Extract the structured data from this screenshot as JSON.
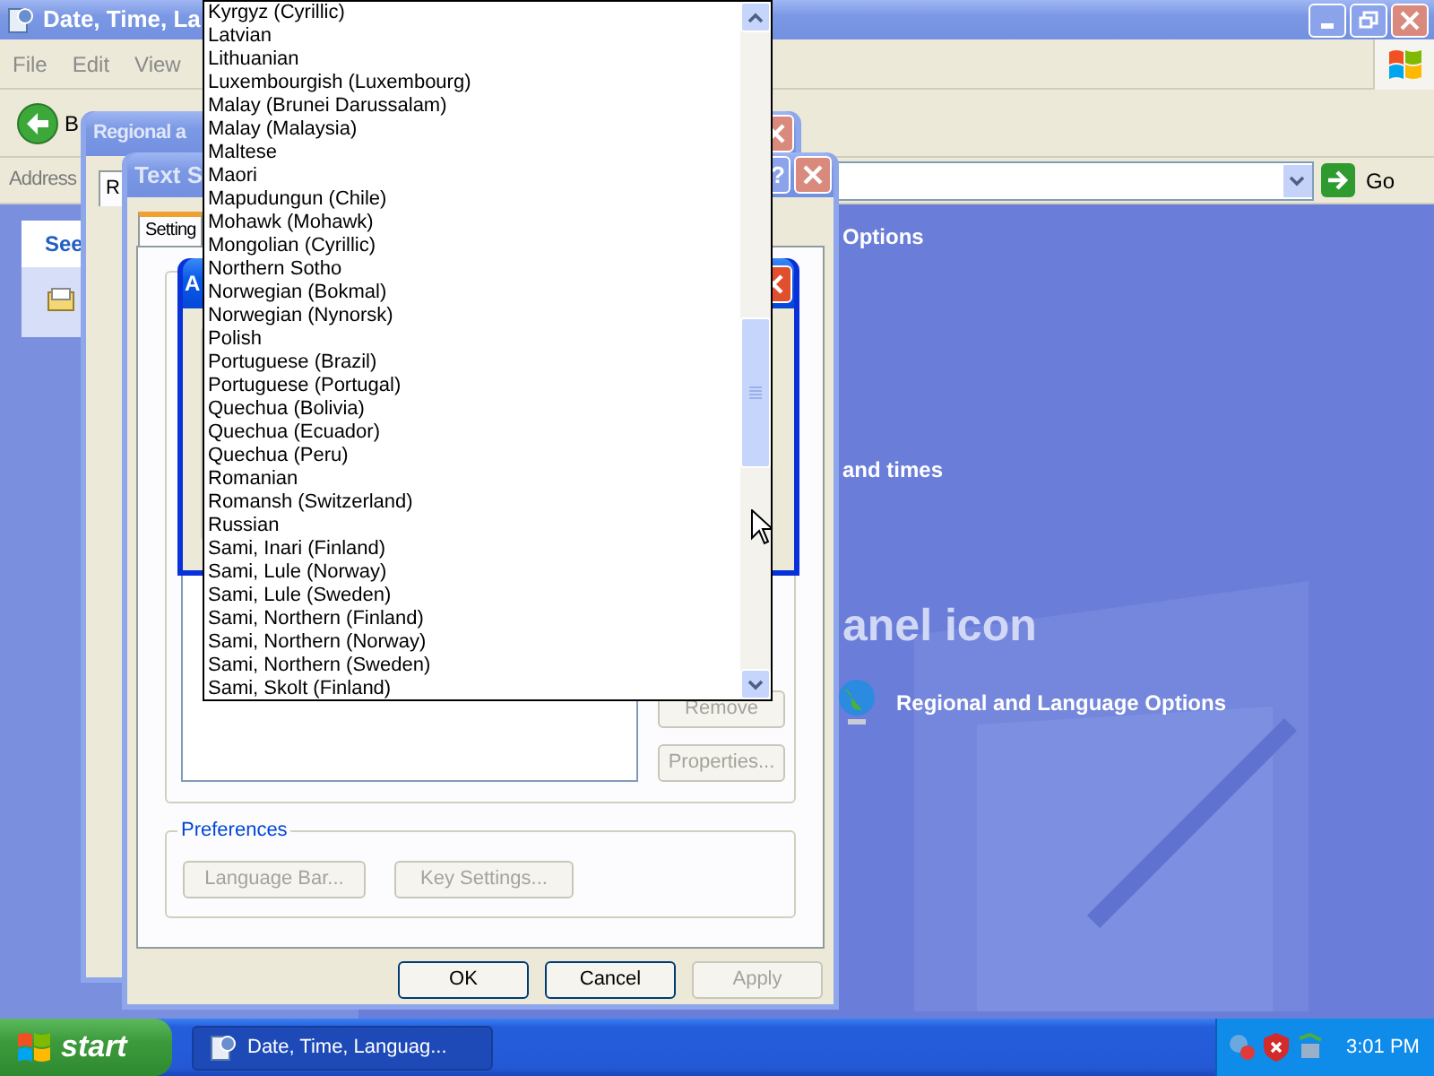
{
  "explorer": {
    "title": "Date, Time, La",
    "menu": [
      "File",
      "Edit",
      "View"
    ],
    "back_label": "B",
    "address_label": "Address",
    "go_label": "Go",
    "sidebar_heading": "See",
    "content": {
      "heading": "Options",
      "subheading": "and times",
      "panel_title": "anel icon",
      "link": "Regional and Language Options"
    }
  },
  "regional_dialog": {
    "title": "Regional a",
    "tab": "R"
  },
  "text_services_dialog": {
    "title": "Text S",
    "help": "?",
    "tab": "Setting",
    "side_buttons": [
      {
        "label": "Remove",
        "disabled": true
      },
      {
        "label": "Properties...",
        "disabled": true
      }
    ],
    "preferences": {
      "label": "Preferences",
      "buttons": [
        {
          "label": "Language Bar...",
          "disabled": true
        },
        {
          "label": "Key Settings...",
          "disabled": true
        }
      ]
    },
    "footer_buttons": [
      {
        "label": "OK",
        "disabled": false
      },
      {
        "label": "Cancel",
        "disabled": false
      },
      {
        "label": "Apply",
        "disabled": true
      }
    ]
  },
  "add_dialog": {
    "title": "A"
  },
  "dropdown": {
    "items": [
      "Kyrgyz (Cyrillic)",
      "Latvian",
      "Lithuanian",
      "Luxembourgish (Luxembourg)",
      "Malay (Brunei Darussalam)",
      "Malay (Malaysia)",
      "Maltese",
      "Maori",
      "Mapudungun (Chile)",
      "Mohawk (Mohawk)",
      "Mongolian (Cyrillic)",
      "Northern Sotho",
      "Norwegian (Bokmal)",
      "Norwegian (Nynorsk)",
      "Polish",
      "Portuguese (Brazil)",
      "Portuguese (Portugal)",
      "Quechua (Bolivia)",
      "Quechua (Ecuador)",
      "Quechua (Peru)",
      "Romanian",
      "Romansh (Switzerland)",
      "Russian",
      "Sami, Inari (Finland)",
      "Sami, Lule (Norway)",
      "Sami, Lule (Sweden)",
      "Sami, Northern (Finland)",
      "Sami, Northern (Norway)",
      "Sami, Northern (Sweden)",
      "Sami, Skolt (Finland)"
    ]
  },
  "taskbar": {
    "start": "start",
    "tasks": [
      {
        "label": "Date, Time, Languag...",
        "selected": true
      }
    ],
    "clock": "3:01 PM"
  }
}
